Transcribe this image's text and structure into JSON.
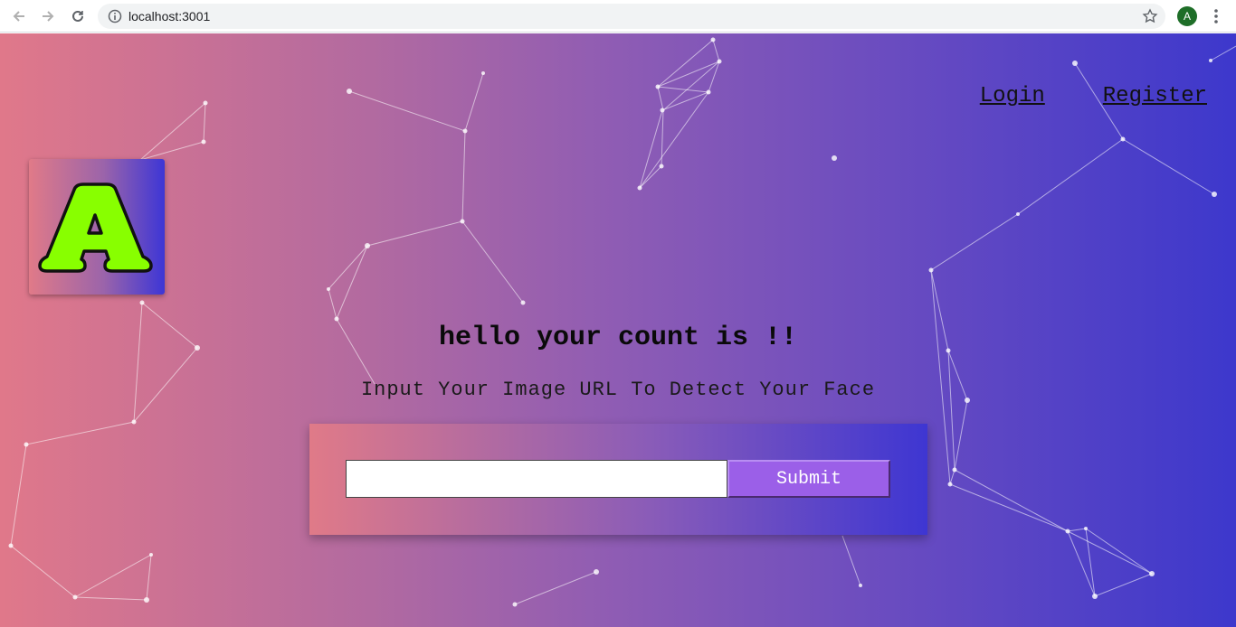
{
  "browser": {
    "url": "localhost:3001",
    "profile_initial": "A"
  },
  "nav": {
    "login_label": "Login",
    "register_label": "Register"
  },
  "logo": {
    "letter": "A",
    "letter_color": "#88ff00"
  },
  "main": {
    "heading": "hello your count is !!",
    "subheading": "Input Your Image URL To Detect Your Face",
    "input_value": "",
    "submit_label": "Submit"
  },
  "colors": {
    "gradient_start": "#e0788a",
    "gradient_end": "#3d38cc",
    "button": "#9b5fe8"
  }
}
